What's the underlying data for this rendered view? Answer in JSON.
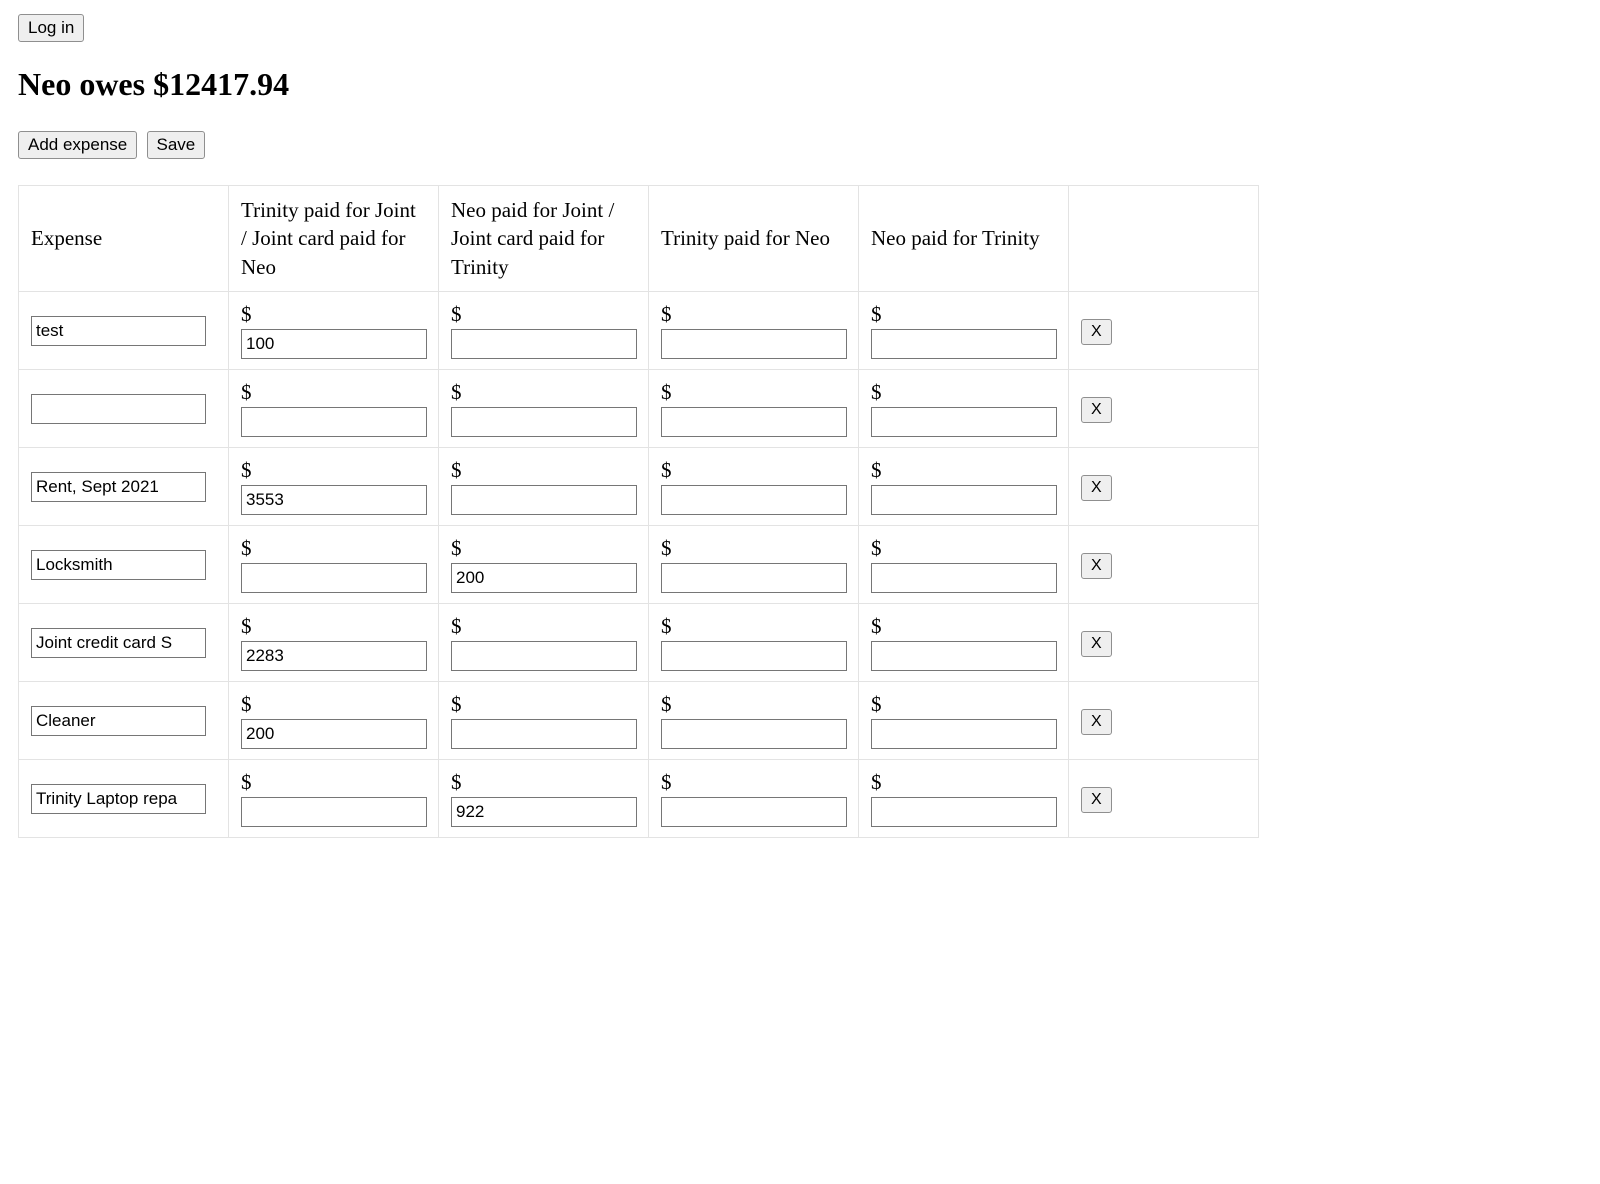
{
  "login_label": "Log in",
  "balance_heading": "Neo owes $12417.94",
  "toolbar": {
    "add_label": "Add expense",
    "save_label": "Save"
  },
  "currency_symbol": "$",
  "delete_label": "X",
  "columns": {
    "name": "Expense",
    "c1": "Trinity paid for Joint / Joint card paid for Neo",
    "c2": "Neo paid for Joint / Joint card paid for Trinity",
    "c3": "Trinity paid for Neo",
    "c4": "Neo paid for Trinity"
  },
  "rows": [
    {
      "name": "test",
      "c1": "100",
      "c2": "",
      "c3": "",
      "c4": ""
    },
    {
      "name": "",
      "c1": "",
      "c2": "",
      "c3": "",
      "c4": ""
    },
    {
      "name": "Rent, Sept 2021",
      "c1": "3553",
      "c2": "",
      "c3": "",
      "c4": ""
    },
    {
      "name": "Locksmith",
      "c1": "",
      "c2": "200",
      "c3": "",
      "c4": ""
    },
    {
      "name": "Joint credit card S",
      "c1": "2283",
      "c2": "",
      "c3": "",
      "c4": ""
    },
    {
      "name": "Cleaner",
      "c1": "200",
      "c2": "",
      "c3": "",
      "c4": ""
    },
    {
      "name": "Trinity Laptop repa",
      "c1": "",
      "c2": "922",
      "c3": "",
      "c4": ""
    }
  ]
}
